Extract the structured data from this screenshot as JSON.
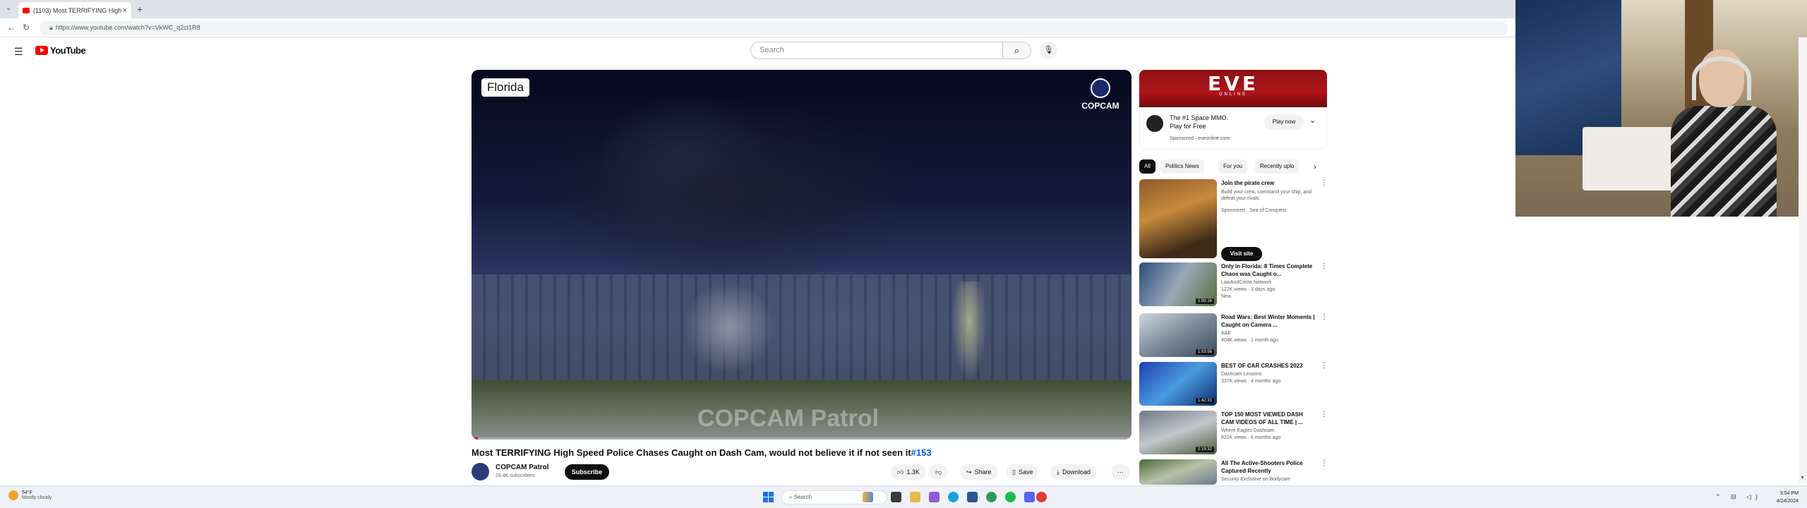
{
  "browser": {
    "tab_title": "(1103) Most TERRIFYING High",
    "url": "https://www.youtube.com/watch?v=VkWC_q2ct1R8"
  },
  "youtube": {
    "logo_text": "YouTube",
    "search_placeholder": "Search"
  },
  "video": {
    "location_badge": "Florida",
    "channel_logo_text": "COPCAM",
    "watermark": "COPCAM Patrol",
    "progress_fraction": 0.01,
    "title": "Most TERRIFYING High Speed Police Chases Caught on Dash Cam, would not believe it if not seen it",
    "title_tag": "#153",
    "channel_name": "COPCAM Patrol",
    "channel_subs": "29.4K subscribers",
    "subscribe_label": "Subscribe",
    "like_count": "1.3K",
    "share_label": "Share",
    "save_label": "Save",
    "download_label": "Download"
  },
  "sidebar": {
    "ad": {
      "banner_text": "EVE",
      "banner_sub": "ONLINE",
      "headline": "The #1 Space MMO. Play for Free",
      "sponsor_line": "Sponsored · eveonline.com",
      "cta": "Play now"
    },
    "chips": [
      "All",
      "Politics News",
      "For you",
      "Recently uplo"
    ],
    "recs": [
      {
        "title": "Join the pirate crew",
        "line1": "Build your crew, command your ship, and defeat your rivals.",
        "line2": "Sponsored · Sea of Conquest",
        "cta": "Visit site",
        "duration": ""
      },
      {
        "title": "Only in Florida: 8 Times Complete Chaos was Caught o...",
        "line1": "LawAndCrime Network",
        "line2": "122K views · 3 days ago",
        "line3": "New",
        "duration": "1:50:16"
      },
      {
        "title": "Road Wars: Best Winter Moments | Caught on Camera ...",
        "line1": "A&E",
        "line2": "404K views · 1 month ago",
        "duration": "1:53:56"
      },
      {
        "title": "BEST OF CAR CRASHES 2023",
        "line1": "Dashcam Lessons",
        "line2": "337K views · 4 months ago",
        "duration": "1:42:31"
      },
      {
        "title": "TOP 150 MOST VIEWED DASH CAM VIDEOS OF ALL TIME | ...",
        "line1": "Where Eagles Dashcam",
        "line2": "822K views · 6 months ago",
        "duration": "2:19:32"
      },
      {
        "title": "All The Active-Shooters Police Captured Recently",
        "line1": "Security Exclusive on Bodycam",
        "line2": "",
        "duration": ""
      }
    ]
  },
  "taskbar": {
    "weather_temp": "54°F",
    "weather_desc": "Mostly cloudy",
    "search_label": "Search",
    "time": "3:54 PM",
    "date": "4/24/2024"
  }
}
